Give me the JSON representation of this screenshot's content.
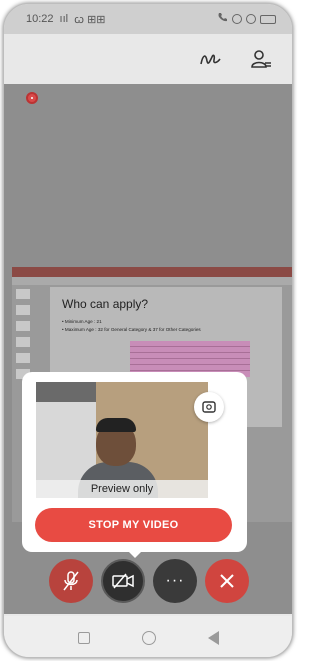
{
  "status_bar": {
    "time": "10:22",
    "signal": "ııl",
    "notifications": "ꞷ ⊞⊞"
  },
  "preview": {
    "label": "Preview only",
    "stop_button": "STOP MY VIDEO"
  },
  "slide": {
    "title": "Who can apply?",
    "bullets": [
      "• Minimum Age : 21",
      "• Maximum Age : 32 for General Category & 37 for Other Categories"
    ]
  },
  "controls": [
    {
      "name": "mute",
      "icon": "mic-off-icon"
    },
    {
      "name": "video",
      "icon": "video-off-icon"
    },
    {
      "name": "more",
      "icon": "more-icon",
      "label": "···"
    },
    {
      "name": "leave",
      "icon": "close-icon"
    }
  ],
  "colors": {
    "accent": "#e84b43",
    "dark_button": "#3a3a3a",
    "overlay": "#8e8e8e"
  }
}
